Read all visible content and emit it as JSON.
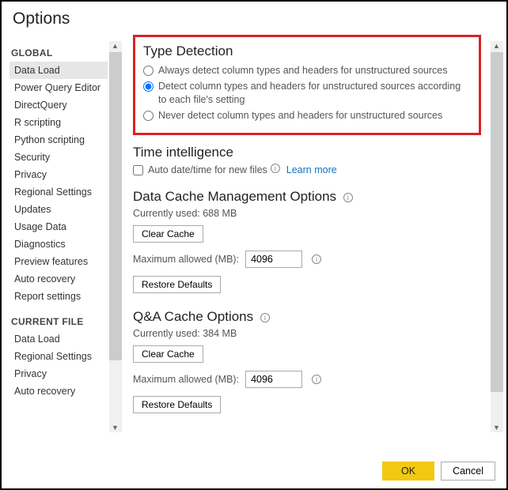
{
  "title": "Options",
  "sidebar": {
    "group_global": "GLOBAL",
    "group_current": "CURRENT FILE",
    "global_items": [
      "Data Load",
      "Power Query Editor",
      "DirectQuery",
      "R scripting",
      "Python scripting",
      "Security",
      "Privacy",
      "Regional Settings",
      "Updates",
      "Usage Data",
      "Diagnostics",
      "Preview features",
      "Auto recovery",
      "Report settings"
    ],
    "current_items": [
      "Data Load",
      "Regional Settings",
      "Privacy",
      "Auto recovery"
    ]
  },
  "type_detection": {
    "heading": "Type Detection",
    "opt_always": "Always detect column types and headers for unstructured sources",
    "opt_detect": "Detect column types and headers for unstructured sources according to each file's setting",
    "opt_never": "Never detect column types and headers for unstructured sources"
  },
  "time_intel": {
    "heading": "Time intelligence",
    "auto_label": "Auto date/time for new files",
    "learn_more": "Learn more"
  },
  "data_cache": {
    "heading": "Data Cache Management Options",
    "currently_used_label": "Currently used: 688 MB",
    "clear_cache": "Clear Cache",
    "max_label": "Maximum allowed (MB):",
    "max_value": "4096",
    "restore": "Restore Defaults"
  },
  "qa_cache": {
    "heading": "Q&A Cache Options",
    "currently_used_label": "Currently used: 384 MB",
    "clear_cache": "Clear Cache",
    "max_label": "Maximum allowed (MB):",
    "max_value": "4096",
    "restore": "Restore Defaults"
  },
  "footer": {
    "ok": "OK",
    "cancel": "Cancel"
  }
}
